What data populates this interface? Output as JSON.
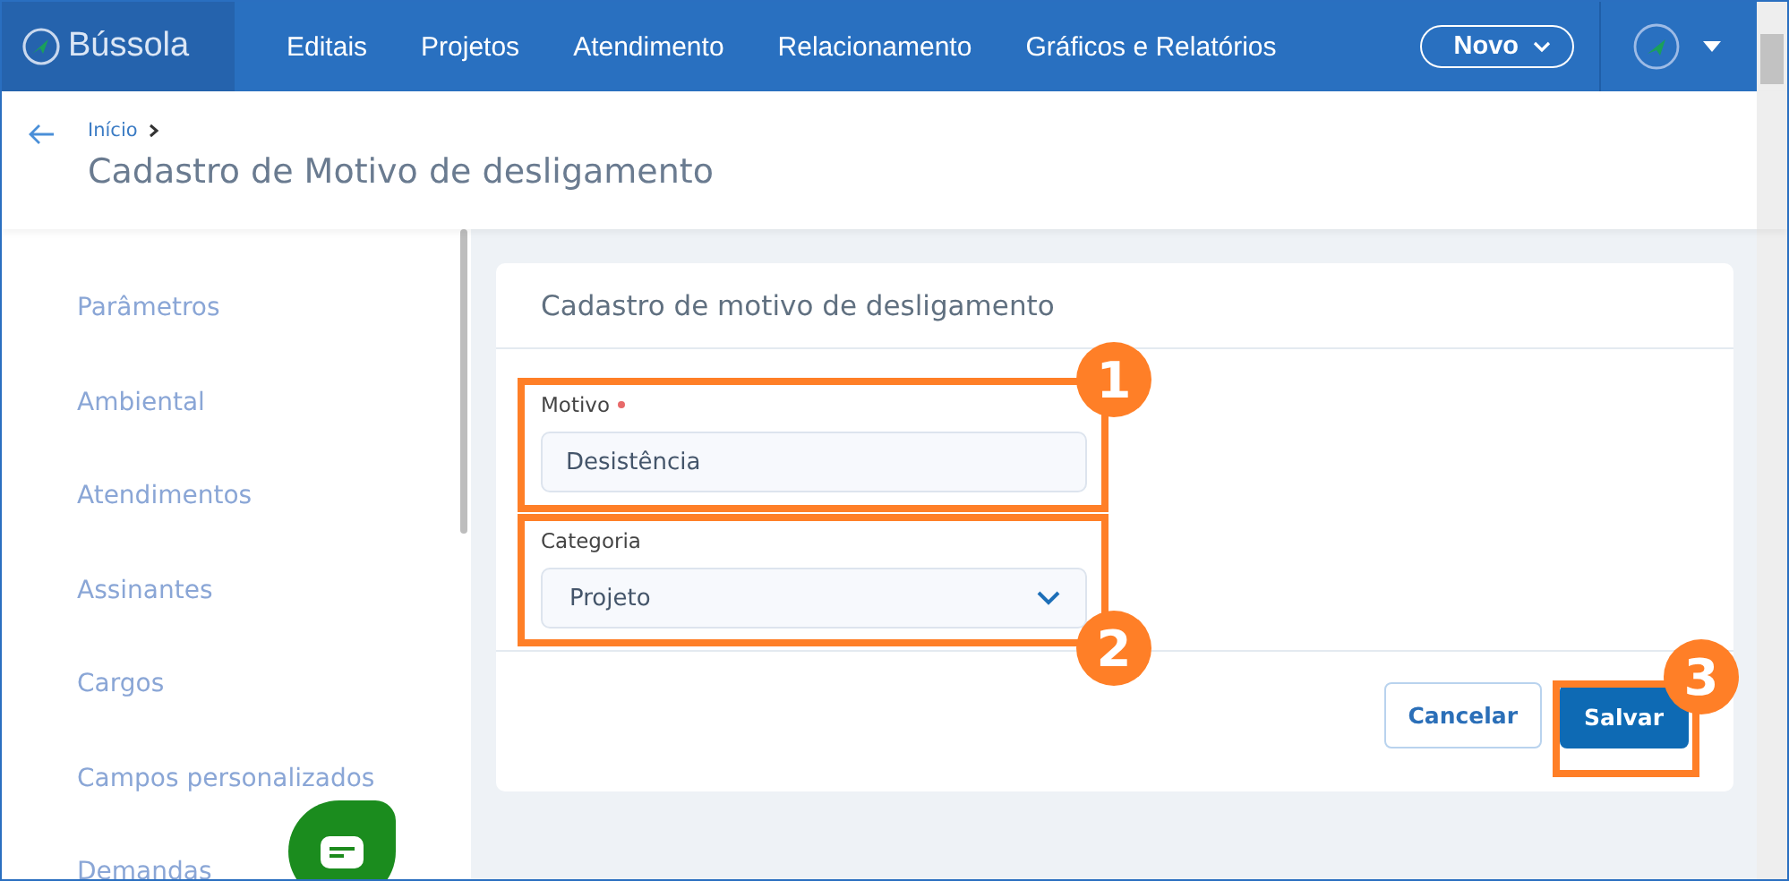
{
  "brand": "Bússola",
  "nav": [
    {
      "label": "Editais"
    },
    {
      "label": "Projetos"
    },
    {
      "label": "Atendimento"
    },
    {
      "label": "Relacionamento"
    },
    {
      "label": "Gráficos e Relatórios"
    }
  ],
  "new_button": "Novo",
  "breadcrumb": [
    "Início"
  ],
  "page_title": "Cadastro de Motivo de desligamento",
  "sidebar": {
    "items": [
      {
        "label": "Parâmetros"
      },
      {
        "label": "Ambiental"
      },
      {
        "label": "Atendimentos"
      },
      {
        "label": "Assinantes"
      },
      {
        "label": "Cargos"
      },
      {
        "label": "Campos personalizados"
      },
      {
        "label": "Demandas"
      }
    ]
  },
  "card": {
    "title": "Cadastro de motivo de desligamento",
    "fields": [
      {
        "kind": "text",
        "label": "Motivo",
        "required": true,
        "value": "Desistência"
      },
      {
        "kind": "select",
        "label": "Categoria",
        "required": false,
        "value": "Projeto"
      }
    ],
    "buttons": [
      {
        "label": "Cancelar",
        "kind": "secondary"
      },
      {
        "label": "Salvar",
        "kind": "primary"
      }
    ]
  },
  "annotations": [
    {
      "number": "1"
    },
    {
      "number": "2"
    },
    {
      "number": "3"
    }
  ]
}
